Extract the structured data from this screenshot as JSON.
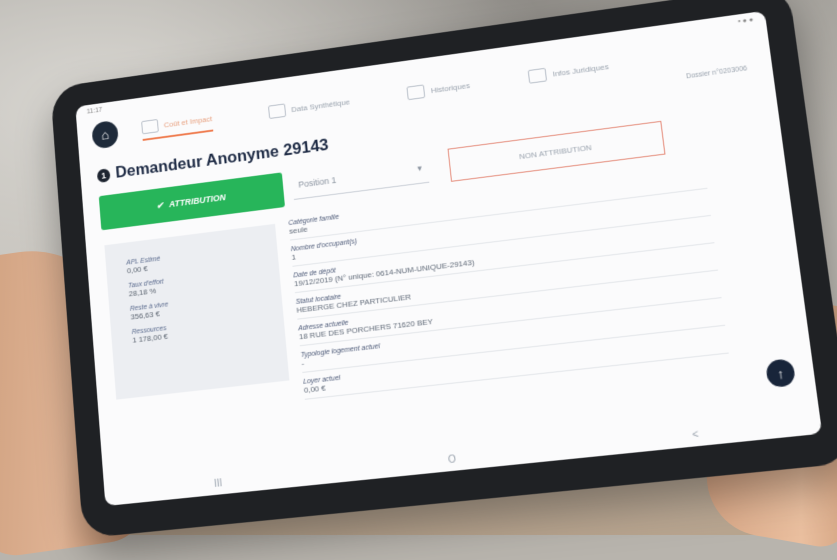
{
  "tabs": [
    {
      "label": "Coût et Impact"
    },
    {
      "label": "Data Synthétique"
    },
    {
      "label": "Historiques"
    },
    {
      "label": "Infos Juridiques"
    }
  ],
  "status": {
    "time": "11:17",
    "icons": "▪ ● ●"
  },
  "dossier": "Dossier n°0203006",
  "header": {
    "num": "1",
    "title": "Demandeur Anonyme 29143"
  },
  "actions": {
    "attribution": "ATTRIBUTION",
    "position": "Position 1",
    "non_attribution": "NON ATTRIBUTION"
  },
  "summary": [
    {
      "label": "APL Estimé",
      "value": "0,00 €"
    },
    {
      "label": "Taux d'effort",
      "value": "28,18 %"
    },
    {
      "label": "Reste à vivre",
      "value": "356,63 €"
    },
    {
      "label": "Ressources",
      "value": "1 178,00 €"
    }
  ],
  "details": [
    {
      "label": "Catégorie famille",
      "value": "seule"
    },
    {
      "label": "Nombre d'occupant(s)",
      "value": "1"
    },
    {
      "label": "Date de dépôt",
      "value": "19/12/2019 (N° unique: 0614-NUM-UNIQUE-29143)"
    },
    {
      "label": "Statut locataire",
      "value": "HEBERGE CHEZ PARTICULIER"
    },
    {
      "label": "Adresse actuelle",
      "value": "18 RUE DES PORCHERS 71620 BEY"
    },
    {
      "label": "Typologie logement actuel",
      "value": "-"
    },
    {
      "label": "Loyer actuel",
      "value": "0,00 €"
    }
  ],
  "navbar": [
    "III",
    "O",
    "<"
  ]
}
